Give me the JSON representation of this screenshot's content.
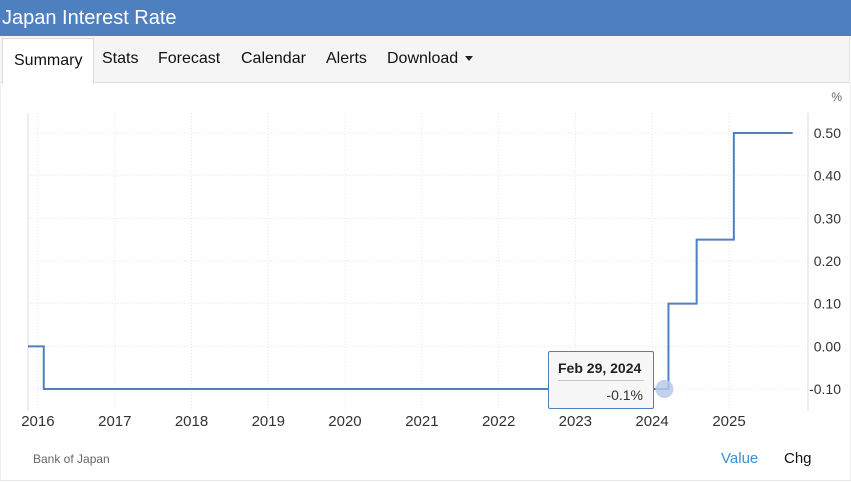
{
  "header": {
    "title": "Japan Interest Rate"
  },
  "tabs": [
    {
      "label": "Summary",
      "active": true
    },
    {
      "label": "Stats"
    },
    {
      "label": "Forecast"
    },
    {
      "label": "Calendar"
    },
    {
      "label": "Alerts"
    },
    {
      "label": "Download",
      "dropdown": true
    }
  ],
  "tooltip": {
    "date": "Feb 29, 2024",
    "value": "-0.1%"
  },
  "footer": {
    "source": "Bank of Japan",
    "toggle_value": "Value",
    "toggle_chg": "Chg"
  },
  "colors": {
    "header": "#4e80bf",
    "line": "#4e80bf",
    "accent": "#3b8fd0",
    "marker": "#b7c9ea"
  },
  "chart_data": {
    "type": "line",
    "step": true,
    "unit_label": "%",
    "x_tick_labels": [
      "2016",
      "2017",
      "2018",
      "2019",
      "2020",
      "2021",
      "2022",
      "2023",
      "2024",
      "2025"
    ],
    "y_tick_labels": [
      "0.50",
      "0.40",
      "0.30",
      "0.20",
      "0.10",
      "0.00",
      "-0.10"
    ],
    "y_ticks": [
      0.5,
      0.4,
      0.3,
      0.2,
      0.1,
      0.0,
      -0.1
    ],
    "ylim": [
      -0.1,
      0.5
    ],
    "xlim": [
      "2015-11-15",
      "2025-11-30"
    ],
    "y_axis_side": "right",
    "grid": true,
    "series": [
      {
        "values": [
          {
            "x": "2015-11-15",
            "y": 0.0
          },
          {
            "x": "2016-01-29",
            "y": -0.1
          },
          {
            "x": "2024-03-19",
            "y": 0.1
          },
          {
            "x": "2024-07-31",
            "y": 0.25
          },
          {
            "x": "2025-01-24",
            "y": 0.5
          },
          {
            "x": "2025-10-31",
            "y": 0.5
          }
        ]
      }
    ],
    "highlight": {
      "x": "2024-02-29",
      "y": -0.1
    }
  }
}
